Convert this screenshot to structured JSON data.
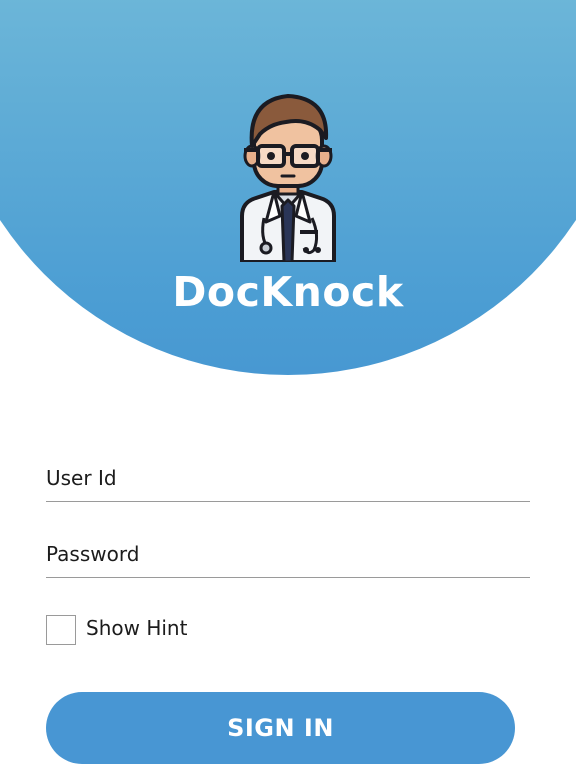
{
  "app": {
    "title": "DocKnock",
    "logo_icon": "doctor-avatar-icon"
  },
  "login_form": {
    "user_id_placeholder": "User Id",
    "password_placeholder": "Password",
    "show_hint_label": "Show Hint",
    "show_hint_checked": false,
    "sign_in_label": "SIGN IN"
  },
  "colors": {
    "header_gradient_top": "#7fcbd8",
    "header_gradient_bottom": "#4898d2",
    "button_background": "#4896d3",
    "field_underline": "#9a9a9a"
  }
}
